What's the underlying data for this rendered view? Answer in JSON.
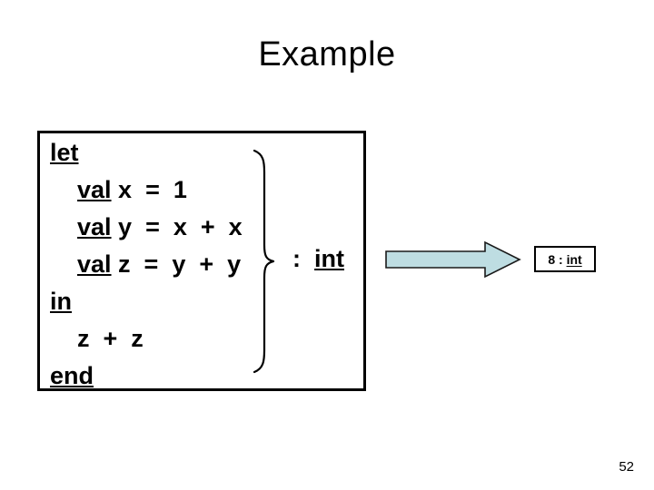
{
  "slide": {
    "title": "Example",
    "page_number": "52"
  },
  "code_block": {
    "language": "sml",
    "lines": [
      {
        "keyword": "let",
        "rest": ""
      },
      {
        "keyword": "val",
        "rest": " x  =  1"
      },
      {
        "keyword": "val",
        "rest": " y  =  x  +  x"
      },
      {
        "keyword": "val",
        "rest": " z  =  y  +  y"
      },
      {
        "keyword": "in",
        "rest": ""
      },
      {
        "keyword": "",
        "rest": "z  +  z"
      },
      {
        "keyword": "end",
        "rest": ""
      }
    ]
  },
  "annotation": {
    "colon": ":",
    "type": "int"
  },
  "arrow": {
    "fill_color": "#BEDDE2",
    "outline_color": "#1A1A1A",
    "direction": "right"
  },
  "result": {
    "value": "8",
    "separator": ":",
    "type": "int"
  }
}
